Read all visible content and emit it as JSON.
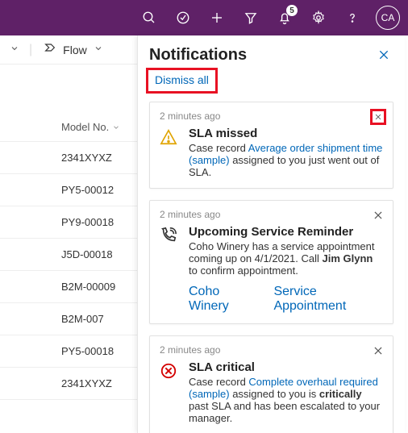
{
  "topbar": {
    "notification_count": "5",
    "avatar_initials": "CA"
  },
  "subbar": {
    "flow_label": "Flow"
  },
  "grid": {
    "header": "Model No.",
    "rows": [
      "2341XYXZ",
      "PY5-00012",
      "PY9-00018",
      "J5D-00018",
      "B2M-00009",
      "B2M-007",
      "PY5-00018",
      "2341XYXZ"
    ]
  },
  "panel": {
    "title": "Notifications",
    "dismiss_all": "Dismiss all"
  },
  "cards": [
    {
      "ts": "2 minutes ago",
      "title": "SLA missed",
      "pre": "Case record ",
      "link": "Average order shipment time (sample)",
      "post": " assigned to you just went out of SLA."
    },
    {
      "ts": "2 minutes ago",
      "title": "Upcoming Service Reminder",
      "pre": "Coho Winery has a service appointment coming up on 4/1/2021. Call ",
      "bold1": "Jim Glynn",
      "post": " to confirm appointment.",
      "link_a": "Coho Winery",
      "link_b": "Service Appointment"
    },
    {
      "ts": "2 minutes ago",
      "title": "SLA critical",
      "pre": "Case record ",
      "link": "Complete overhaul required (sample)",
      "mid": " assigned to you is ",
      "bold1": "critically",
      "post": " past SLA and has been escalated to your manager."
    }
  ]
}
